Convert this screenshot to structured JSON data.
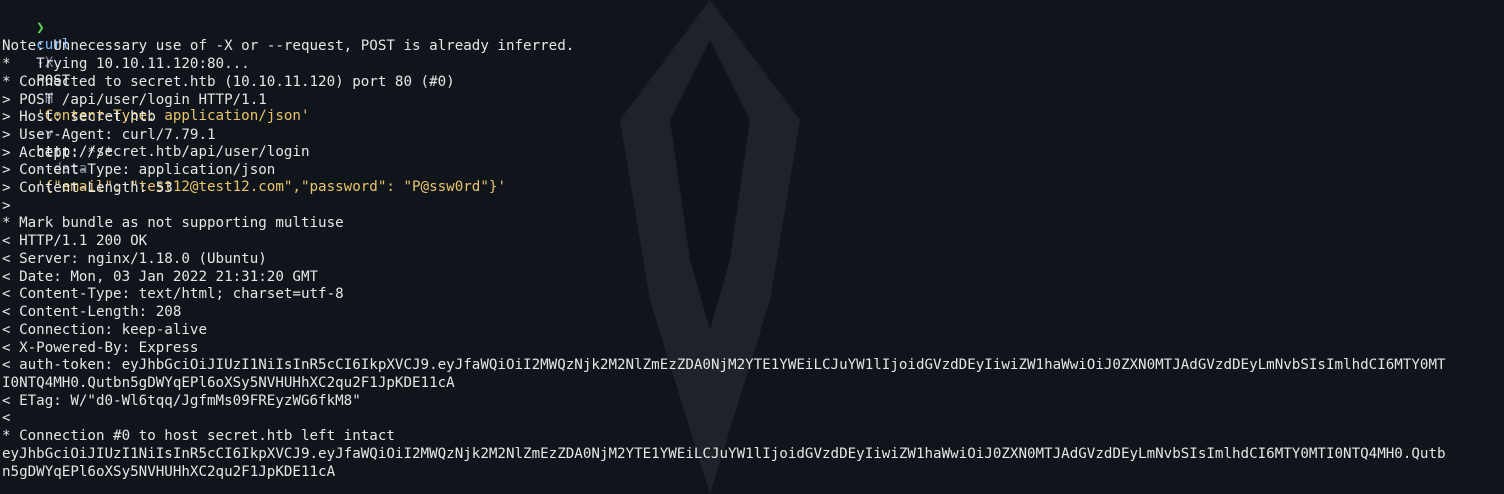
{
  "command": {
    "prompt": "❯",
    "name": "curl",
    "flag_x": "-X",
    "method": "POST",
    "flag_h": "-H",
    "header": "'Content-Type: application/json'",
    "flag_v": "-v",
    "url": "http://secret.htb/api/user/login",
    "flag_data": "--data",
    "data_open": "'",
    "data_body": "{\"email\": \"test12@test12.com\",\"password\": \"P@ssw0rd\"}",
    "data_close": "'"
  },
  "output": [
    "Note: Unnecessary use of -X or --request, POST is already inferred.",
    "*   Trying 10.10.11.120:80...",
    "* Connected to secret.htb (10.10.11.120) port 80 (#0)",
    "> POST /api/user/login HTTP/1.1",
    "> Host: secret.htb",
    "> User-Agent: curl/7.79.1",
    "> Accept: */*",
    "> Content-Type: application/json",
    "> Content-Length: 53",
    ">",
    "* Mark bundle as not supporting multiuse",
    "< HTTP/1.1 200 OK",
    "< Server: nginx/1.18.0 (Ubuntu)",
    "< Date: Mon, 03 Jan 2022 21:31:20 GMT",
    "< Content-Type: text/html; charset=utf-8",
    "< Content-Length: 208",
    "< Connection: keep-alive",
    "< X-Powered-By: Express",
    "< auth-token: eyJhbGciOiJIUzI1NiIsInR5cCI6IkpXVCJ9.eyJfaWQiOiI2MWQzNjk2M2NlZmEzZDA0NjM2YTE1YWEiLCJuYW1lIjoidGVzdDEyIiwiZW1haWwiOiJ0ZXN0MTJAdGVzdDEyLmNvbSIsImlhdCI6MTY0MT",
    "I0NTQ4MH0.Qutbn5gDWYqEPl6oXSy5NVHUHhXC2qu2F1JpKDE11cA",
    "< ETag: W/\"d0-Wl6tqq/JgfmMs09FREyzWG6fkM8\"",
    "<",
    "* Connection #0 to host secret.htb left intact",
    "eyJhbGciOiJIUzI1NiIsInR5cCI6IkpXVCJ9.eyJfaWQiOiI2MWQzNjk2M2NlZmEzZDA0NjM2YTE1YWEiLCJuYW1lIjoidGVzdDEyIiwiZW1haWwiOiJ0ZXN0MTJAdGVzdDEyLmNvbSIsImlhdCI6MTY0MTI0NTQ4MH0.Qutb",
    "n5gDWYqEPl6oXSy5NVHUHhXC2qu2F1JpKDE11cA"
  ]
}
